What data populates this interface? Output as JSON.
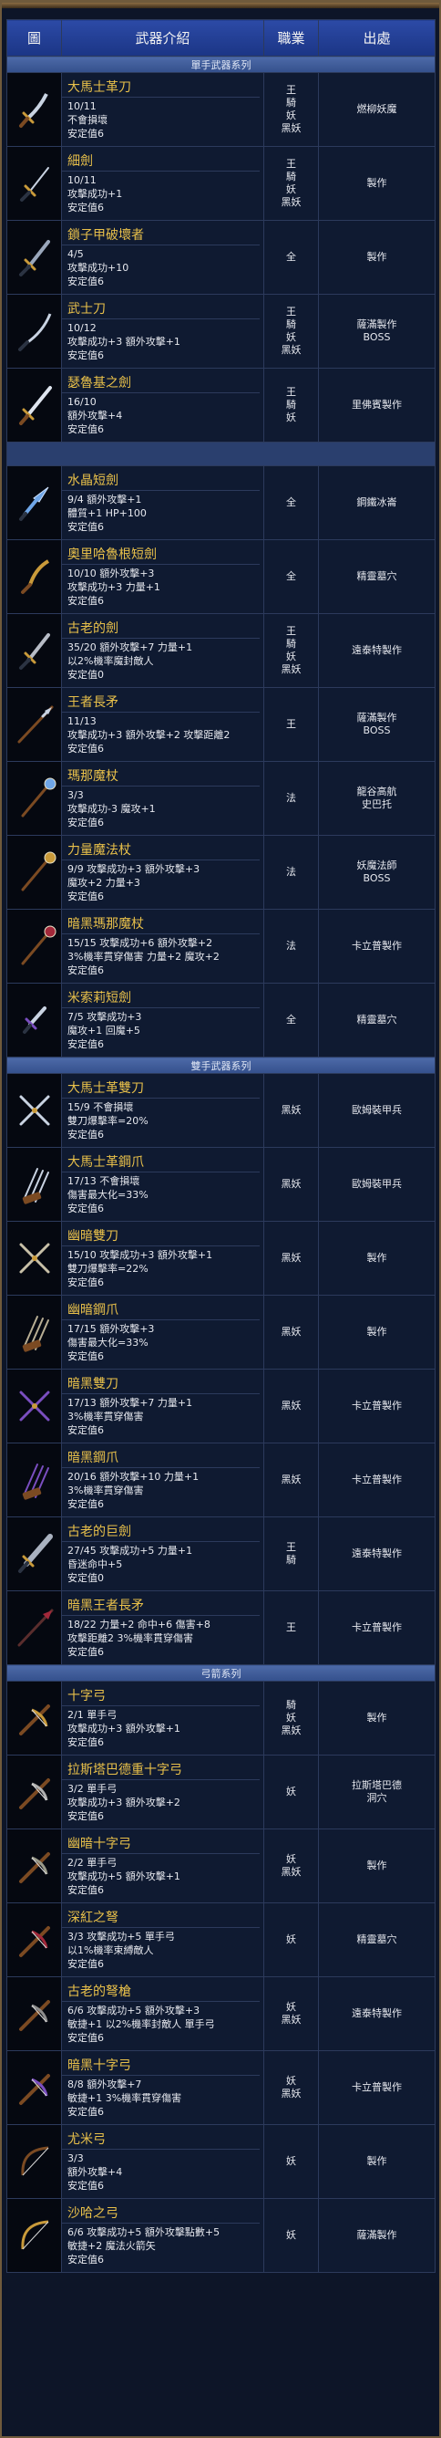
{
  "header": {
    "col_icon": "圖",
    "col_intro": "武器介紹",
    "col_job": "職業",
    "col_source": "出處"
  },
  "sections": [
    {
      "title": "單手武器系列",
      "items": [
        {
          "icon": "saber-icon",
          "name": "大馬士革刀",
          "stats": [
            "10/11",
            "不會損壞",
            "安定值6"
          ],
          "jobs": [
            "王",
            "騎",
            "妖",
            "黑妖"
          ],
          "source": [
            "燃柳妖魔"
          ]
        },
        {
          "icon": "thin-sword-icon",
          "name": "細劍",
          "stats": [
            "10/11",
            "攻擊成功+1",
            "安定值6"
          ],
          "jobs": [
            "王",
            "騎",
            "妖",
            "黑妖"
          ],
          "source": [
            "製作"
          ]
        },
        {
          "icon": "chain-sword-icon",
          "name": "鎖子甲破壞者",
          "stats": [
            "4/5",
            "攻擊成功+10",
            "安定值6"
          ],
          "jobs": [
            "全"
          ],
          "source": [
            "製作"
          ]
        },
        {
          "icon": "katana-icon",
          "name": "武士刀",
          "stats": [
            "10/12",
            "攻擊成功+3 額外攻擊+1",
            "安定值6"
          ],
          "jobs": [
            "王",
            "騎",
            "妖",
            "黑妖"
          ],
          "source": [
            "薩滿製作",
            "BOSS"
          ]
        },
        {
          "icon": "long-sword-icon",
          "name": "瑟魯基之劍",
          "stats": [
            "16/10",
            "額外攻擊+4",
            "安定值6"
          ],
          "jobs": [
            "王",
            "騎",
            "妖"
          ],
          "source": [
            "里佛賓製作"
          ]
        }
      ]
    },
    {
      "title": "",
      "items": [
        {
          "icon": "crystal-dagger-icon",
          "name": "水晶短劍",
          "stats": [
            "9/4 額外攻擊+1",
            "體質+1 HP+100",
            "安定值6"
          ],
          "jobs": [
            "全"
          ],
          "source": [
            "鋼鐵冰崙"
          ]
        },
        {
          "icon": "curved-dagger-icon",
          "name": "奧里哈魯根短劍",
          "stats": [
            "10/10 額外攻擊+3",
            "攻擊成功+3 力量+1",
            "安定值6"
          ],
          "jobs": [
            "全"
          ],
          "source": [
            "精靈墓穴"
          ]
        },
        {
          "icon": "old-sword-icon",
          "name": "古老的劍",
          "stats": [
            "35/20 額外攻擊+7 力量+1",
            "以2%機率魔封敵人",
            "安定值0"
          ],
          "jobs": [
            "王",
            "騎",
            "妖",
            "黑妖"
          ],
          "source": [
            "遠泰特製作"
          ]
        },
        {
          "icon": "spear-icon",
          "name": "王者長矛",
          "stats": [
            "11/13",
            "攻擊成功+3 額外攻擊+2 攻擊距離2",
            "安定值6"
          ],
          "jobs": [
            "王"
          ],
          "source": [
            "薩滿製作",
            "BOSS"
          ]
        },
        {
          "icon": "staff-icon",
          "name": "瑪那魔杖",
          "stats": [
            "3/3",
            "攻擊成功-3 魔攻+1",
            "安定值6"
          ],
          "jobs": [
            "法"
          ],
          "source": [
            "龍谷高航",
            "史巴托"
          ]
        },
        {
          "icon": "power-staff-icon",
          "name": "力量魔法杖",
          "stats": [
            "9/9 攻擊成功+3 額外攻擊+3",
            "魔攻+2 力量+3",
            "安定值6"
          ],
          "jobs": [
            "法"
          ],
          "source": [
            "妖魔法師",
            "BOSS"
          ]
        },
        {
          "icon": "dark-staff-icon",
          "name": "暗黑瑪那魔杖",
          "stats": [
            "15/15 攻擊成功+6 額外攻擊+2",
            "3%機率貫穿傷害 力量+2 魔攻+2",
            "安定值6"
          ],
          "jobs": [
            "法"
          ],
          "source": [
            "卡立普製作"
          ]
        },
        {
          "icon": "short-dagger-icon",
          "name": "米索莉短劍",
          "stats": [
            "7/5 攻擊成功+3",
            "魔攻+1 回魔+5",
            "安定值6"
          ],
          "jobs": [
            "全"
          ],
          "source": [
            "精靈墓穴"
          ]
        }
      ]
    },
    {
      "title": "雙手武器系列",
      "items": [
        {
          "icon": "dual-blade-icon",
          "name": "大馬士革雙刀",
          "stats": [
            "15/9 不會損壞",
            "雙刀爆擊率=20%",
            "安定值6"
          ],
          "jobs": [
            "黑妖"
          ],
          "source": [
            "歐姆裝甲兵"
          ]
        },
        {
          "icon": "claw-icon",
          "name": "大馬士革鋼爪",
          "stats": [
            "17/13 不會損壞",
            "傷害最大化=33%",
            "安定值6"
          ],
          "jobs": [
            "黑妖"
          ],
          "source": [
            "歐姆裝甲兵"
          ]
        },
        {
          "icon": "ghost-dual-blade-icon",
          "name": "幽暗雙刀",
          "stats": [
            "15/10 攻擊成功+3 額外攻擊+1",
            "雙刀爆擊率=22%",
            "安定值6"
          ],
          "jobs": [
            "黑妖"
          ],
          "source": [
            "製作"
          ]
        },
        {
          "icon": "ghost-claw-icon",
          "name": "幽暗鋼爪",
          "stats": [
            "17/15 額外攻擊+3",
            "傷害最大化=33%",
            "安定值6"
          ],
          "jobs": [
            "黑妖"
          ],
          "source": [
            "製作"
          ]
        },
        {
          "icon": "dark-dual-blade-icon",
          "name": "暗黑雙刀",
          "stats": [
            "17/13 額外攻擊+7 力量+1",
            "3%機率貫穿傷害",
            "安定值6"
          ],
          "jobs": [
            "黑妖"
          ],
          "source": [
            "卡立普製作"
          ]
        },
        {
          "icon": "dark-claw-icon",
          "name": "暗黑鋼爪",
          "stats": [
            "20/16 額外攻擊+10 力量+1",
            "3%機率貫穿傷害",
            "安定值6"
          ],
          "jobs": [
            "黑妖"
          ],
          "source": [
            "卡立普製作"
          ]
        },
        {
          "icon": "great-sword-icon",
          "name": "古老的巨劍",
          "stats": [
            "27/45 攻擊成功+5 力量+1",
            "昏迷命中+5",
            "安定值0"
          ],
          "jobs": [
            "王",
            "騎"
          ],
          "source": [
            "遠泰特製作"
          ]
        },
        {
          "icon": "dark-spear-icon",
          "name": "暗黑王者長矛",
          "stats": [
            "18/22 力量+2 命中+6 傷害+8",
            "攻擊距離2 3%機率貫穿傷害",
            "安定值6"
          ],
          "jobs": [
            "王"
          ],
          "source": [
            "卡立普製作"
          ]
        }
      ]
    },
    {
      "title": "弓箭系列",
      "items": [
        {
          "icon": "crossbow-icon",
          "name": "十字弓",
          "stats": [
            "2/1 單手弓",
            "攻擊成功+3 額外攻擊+1",
            "安定值6"
          ],
          "jobs": [
            "騎",
            "妖",
            "黑妖"
          ],
          "source": [
            "製作"
          ]
        },
        {
          "icon": "lastabad-crossbow-icon",
          "name": "拉斯塔巴德重十字弓",
          "stats": [
            "3/2 單手弓",
            "攻擊成功+3 額外攻擊+2",
            "安定值6"
          ],
          "jobs": [
            "妖"
          ],
          "source": [
            "拉斯塔巴德",
            "洞穴"
          ]
        },
        {
          "icon": "ghost-crossbow-icon",
          "name": "幽暗十字弓",
          "stats": [
            "2/2 單手弓",
            "攻擊成功+5 額外攻擊+1",
            "安定值6"
          ],
          "jobs": [
            "妖",
            "黑妖"
          ],
          "source": [
            "製作"
          ]
        },
        {
          "icon": "crimson-bow-icon",
          "name": "深紅之弩",
          "stats": [
            "3/3 攻擊成功+5 單手弓",
            "以1%機率束縛敵人",
            "安定值6"
          ],
          "jobs": [
            "妖"
          ],
          "source": [
            "精靈墓穴"
          ]
        },
        {
          "icon": "old-crossbow-icon",
          "name": "古老的弩槍",
          "stats": [
            "6/6 攻擊成功+5 額外攻擊+3",
            "敏捷+1 以2%機率封敵人 單手弓",
            "安定值6"
          ],
          "jobs": [
            "妖",
            "黑妖"
          ],
          "source": [
            "遠泰特製作"
          ]
        },
        {
          "icon": "dark-crossbow-icon",
          "name": "暗黑十字弓",
          "stats": [
            "8/8 額外攻擊+7",
            "敏捷+1 3%機率貫穿傷害",
            "安定值6"
          ],
          "jobs": [
            "妖",
            "黑妖"
          ],
          "source": [
            "卡立普製作"
          ]
        },
        {
          "icon": "yumi-bow-icon",
          "name": "尤米弓",
          "stats": [
            "3/3",
            "額外攻擊+4",
            "安定值6"
          ],
          "jobs": [
            "妖"
          ],
          "source": [
            "製作"
          ]
        },
        {
          "icon": "saha-bow-icon",
          "name": "沙哈之弓",
          "stats": [
            "6/6 攻擊成功+5 額外攻擊點數+5",
            "敏捷+2 魔法火箭矢",
            "安定值6"
          ],
          "jobs": [
            "妖"
          ],
          "source": [
            "薩滿製作"
          ]
        }
      ]
    }
  ]
}
